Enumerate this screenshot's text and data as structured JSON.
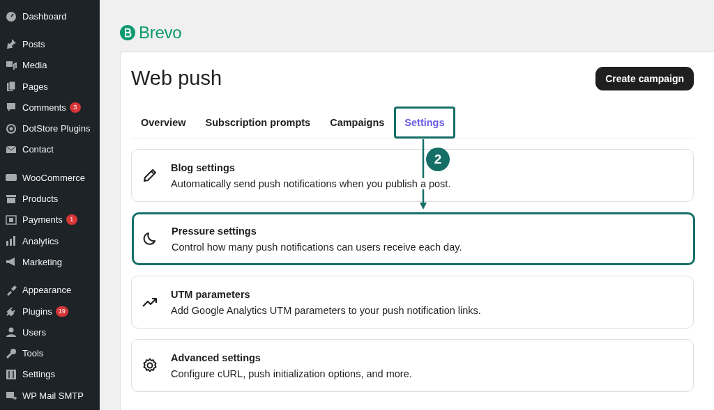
{
  "sidebar": {
    "groups": [
      [
        {
          "label": "Dashboard"
        }
      ],
      [
        {
          "label": "Posts"
        },
        {
          "label": "Media"
        },
        {
          "label": "Pages"
        },
        {
          "label": "Comments",
          "badge": "3"
        },
        {
          "label": "DotStore Plugins"
        },
        {
          "label": "Contact"
        }
      ],
      [
        {
          "label": "WooCommerce"
        },
        {
          "label": "Products"
        },
        {
          "label": "Payments",
          "badge": "1"
        },
        {
          "label": "Analytics"
        },
        {
          "label": "Marketing"
        }
      ],
      [
        {
          "label": "Appearance"
        },
        {
          "label": "Plugins",
          "badge": "19"
        },
        {
          "label": "Users"
        },
        {
          "label": "Tools"
        },
        {
          "label": "Settings"
        },
        {
          "label": "WP Mail SMTP"
        }
      ]
    ]
  },
  "logo": {
    "text": "Brevo"
  },
  "page": {
    "title": "Web push",
    "action": "Create campaign"
  },
  "tabs": [
    {
      "label": "Overview",
      "selected": false,
      "highlighted": false
    },
    {
      "label": "Subscription prompts",
      "selected": false,
      "highlighted": false
    },
    {
      "label": "Campaigns",
      "selected": false,
      "highlighted": false
    },
    {
      "label": "Settings",
      "selected": true,
      "highlighted": true
    }
  ],
  "settings": [
    {
      "title": "Blog settings",
      "description": "Automatically send push notifications when you publish a post.",
      "highlighted": false
    },
    {
      "title": "Pressure settings",
      "description": "Control how many push notifications can users receive each day.",
      "highlighted": true
    },
    {
      "title": "UTM parameters",
      "description": "Add Google Analytics UTM parameters to your push notification links.",
      "highlighted": false
    },
    {
      "title": "Advanced settings",
      "description": "Configure cURL, push initialization options, and more.",
      "highlighted": false
    }
  ],
  "annotation": {
    "step": "2"
  }
}
